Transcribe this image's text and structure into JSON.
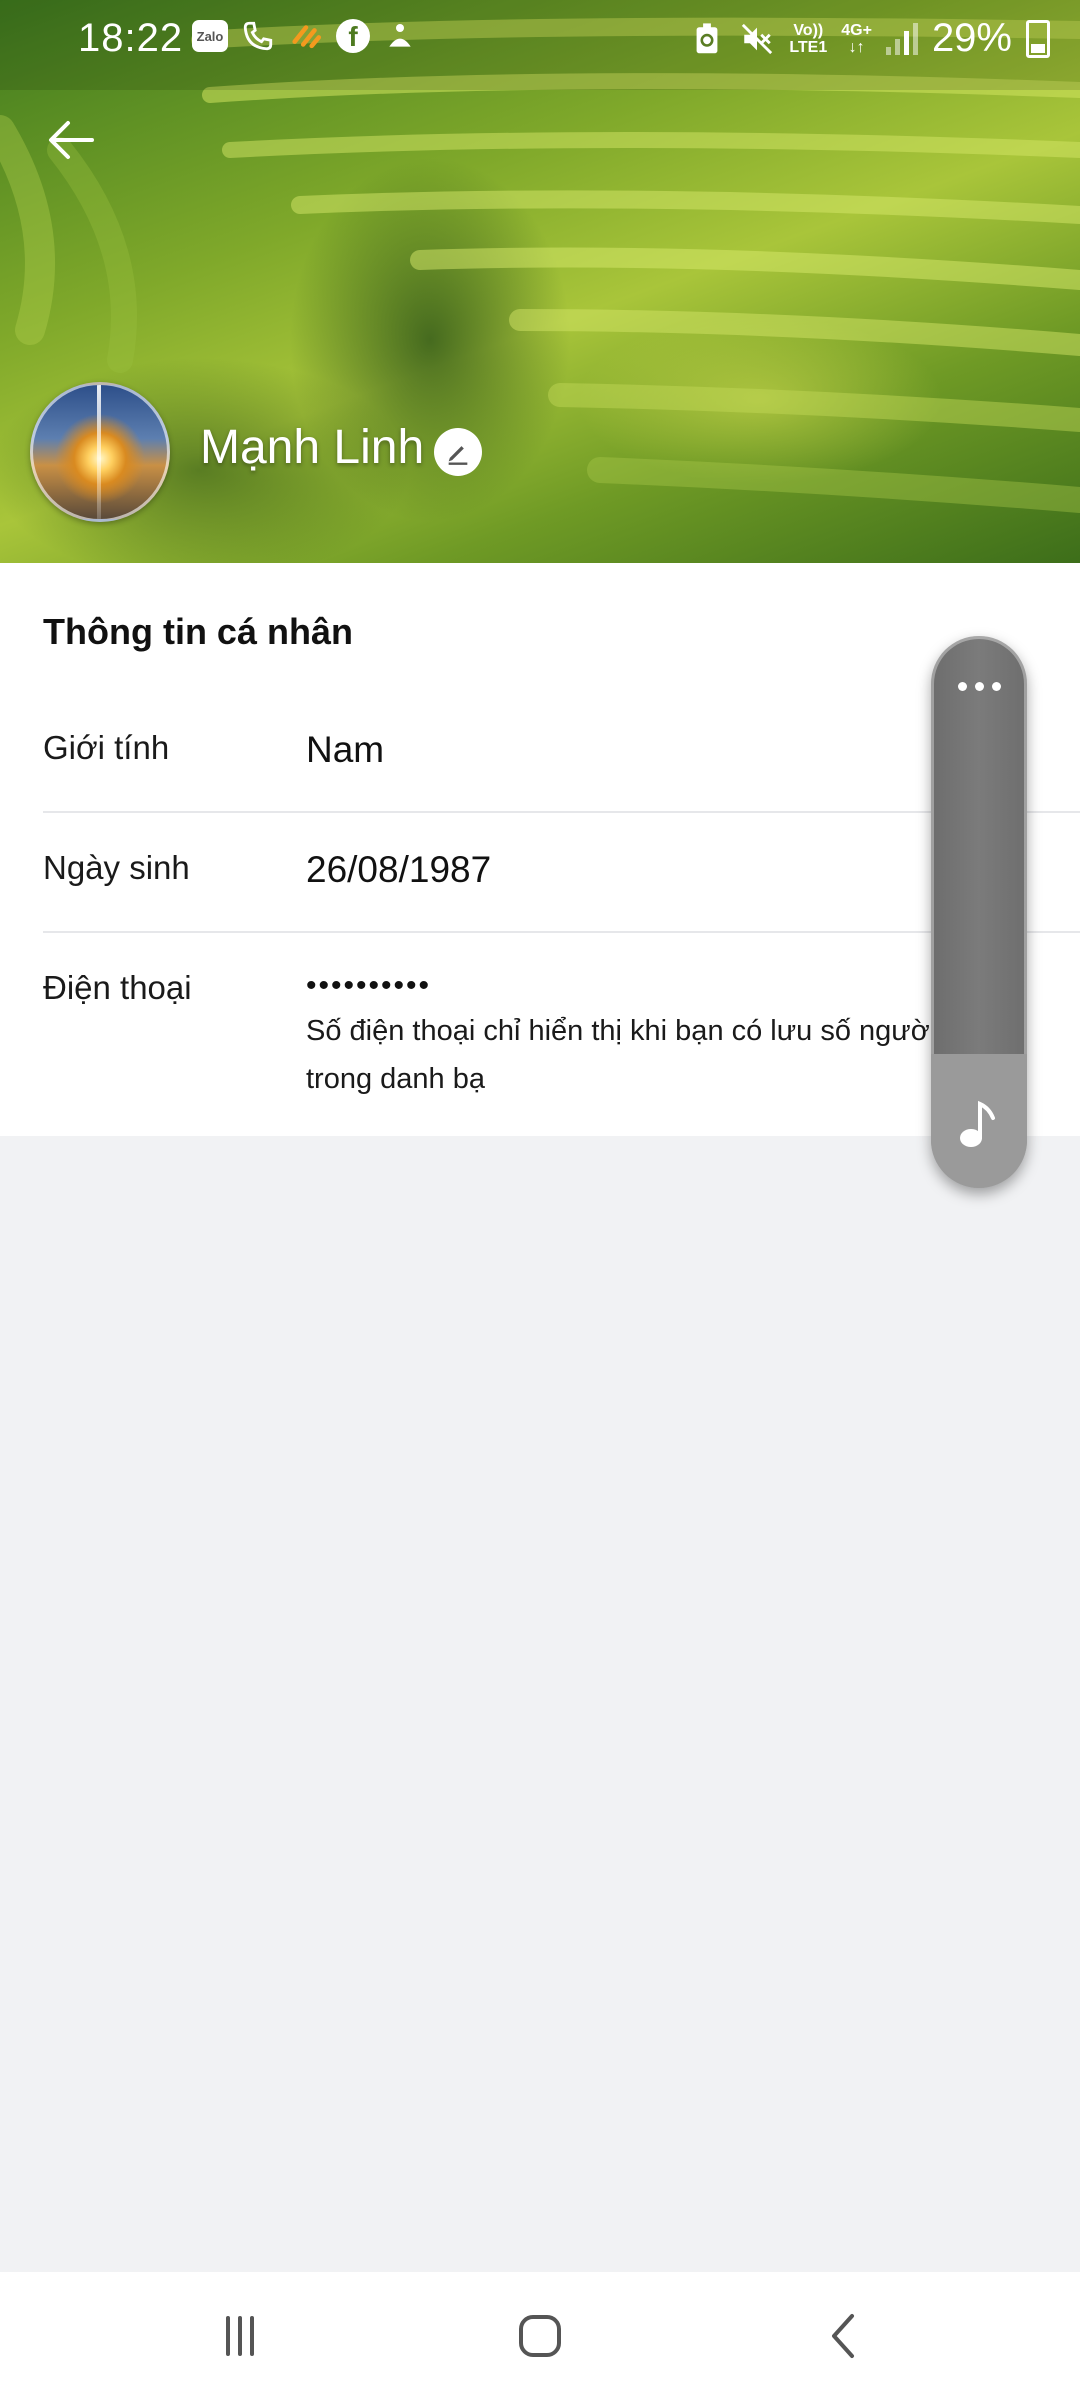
{
  "status_bar": {
    "time": "18:22",
    "battery": "29%",
    "net_top": "Vo))",
    "net_bottom": "LTE1",
    "gen": "4G+",
    "notification_icons": [
      "zalo-icon",
      "phone-call-icon",
      "game-icon",
      "facebook-icon",
      "ring-icon"
    ],
    "zalo_text": "Zalo",
    "facebook_letter": "f"
  },
  "profile": {
    "name": "Mạnh Linh"
  },
  "info": {
    "title": "Thông tin cá nhân",
    "gender_label": "Giới tính",
    "gender_value": "Nam",
    "birthday_label": "Ngày sinh",
    "birthday_value": "26/08/1987",
    "phone_label": "Điện thoại",
    "phone_value": "••••••••••",
    "phone_note": "Số điện thoại chỉ hiển thị khi bạn có lưu số người trong danh bạ"
  },
  "colors": {
    "accent_white": "#ffffff",
    "page_bg": "#f1f2f4",
    "widget_gray": "#777777"
  }
}
